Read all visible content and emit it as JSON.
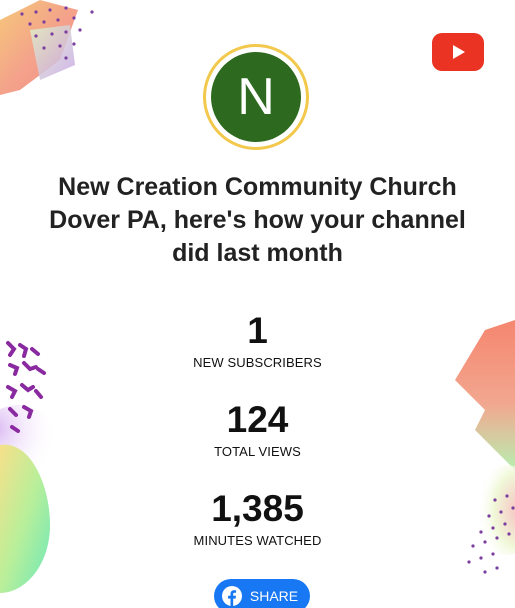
{
  "colors": {
    "youtube_red": "#ea3323",
    "avatar_green": "#2d6a1f",
    "avatar_ring": "#f2c94c",
    "facebook_blue": "#1877f2"
  },
  "avatar": {
    "letter": "N",
    "icon": "channel-avatar"
  },
  "youtube_logo": {
    "icon": "youtube-logo-icon"
  },
  "headline": "New Creation Community Church Dover PA, here's how your channel did last month",
  "stats": [
    {
      "value": "1",
      "label": "NEW SUBSCRIBERS"
    },
    {
      "value": "124",
      "label": "TOTAL VIEWS"
    },
    {
      "value": "1,385",
      "label": "MINUTES WATCHED"
    }
  ],
  "share": {
    "label": "SHARE",
    "icon": "facebook-icon"
  }
}
